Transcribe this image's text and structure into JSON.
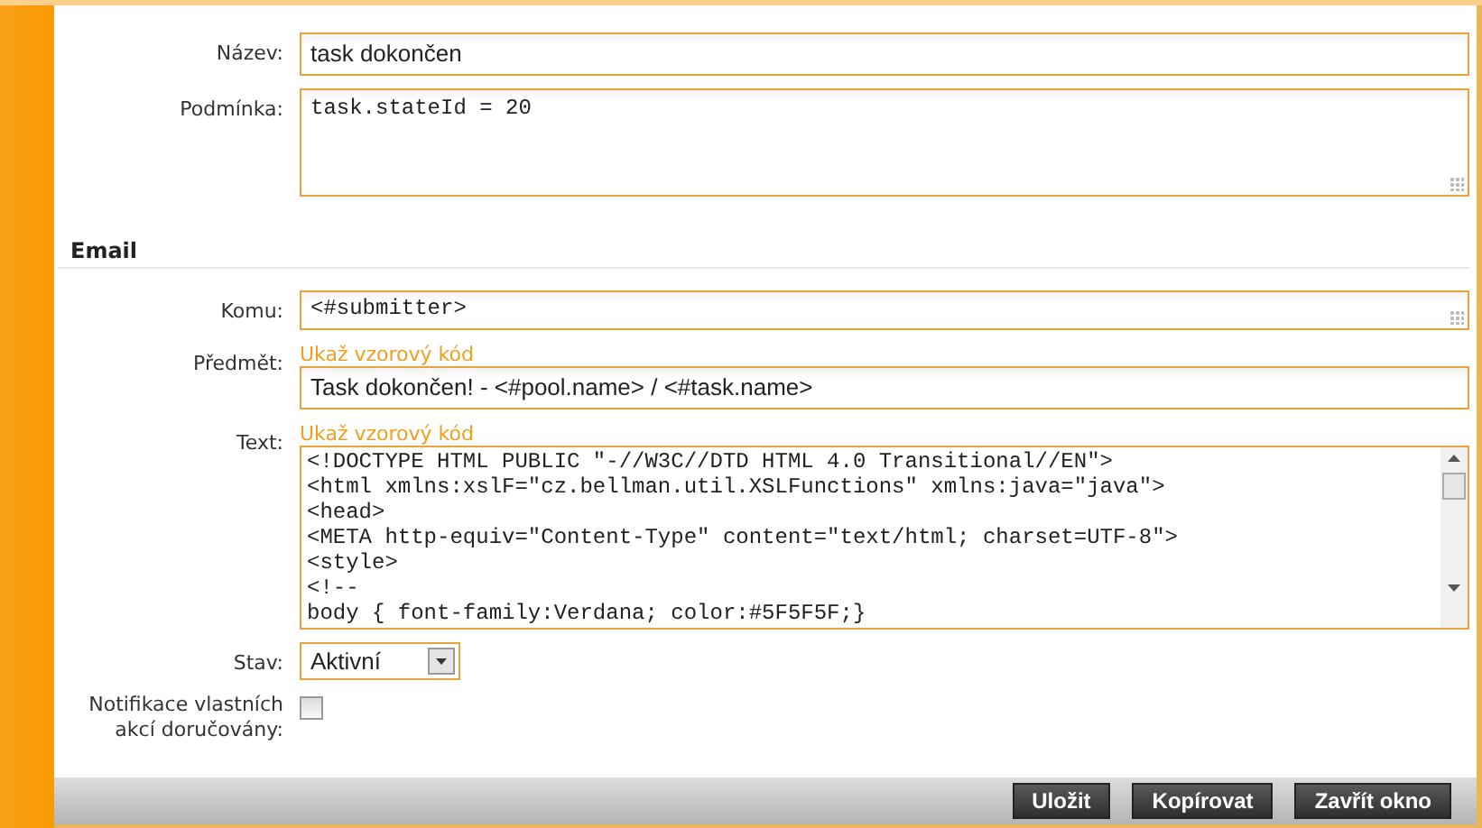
{
  "fields": [
    {
      "kind": "input",
      "label": "Název:",
      "value": "task dokončen"
    },
    {
      "kind": "textarea",
      "label": "Podmínka:",
      "value": "task.stateId = 20"
    }
  ],
  "section": {
    "title": "Email"
  },
  "email_fields": [
    {
      "kind": "mono-input",
      "label": "Komu:",
      "value": "<#submitter>"
    },
    {
      "kind": "input",
      "label": "Předmět:",
      "link": "Ukaž vzorový kód",
      "value": "Task dokončen! - <#pool.name> / <#task.name>"
    },
    {
      "kind": "code",
      "label": "Text:",
      "link": "Ukaž vzorový kód",
      "lines": [
        "<!DOCTYPE HTML PUBLIC \"-//W3C//DTD HTML 4.0 Transitional//EN\">",
        "<html xmlns:xslF=\"cz.bellman.util.XSLFunctions\" xmlns:java=\"java\">",
        "<head>",
        "<META http-equiv=\"Content-Type\" content=\"text/html; charset=UTF-8\">",
        "<style>",
        "<!--",
        "body { font-family:Verdana; color:#5F5F5F;}"
      ]
    }
  ],
  "status": {
    "label": "Stav:",
    "value": "Aktivní"
  },
  "notify": {
    "label": "Notifikace vlastních akcí doručovány:",
    "checked": false
  },
  "buttons": [
    "Uložit",
    "Kopírovat",
    "Zavřít okno"
  ]
}
